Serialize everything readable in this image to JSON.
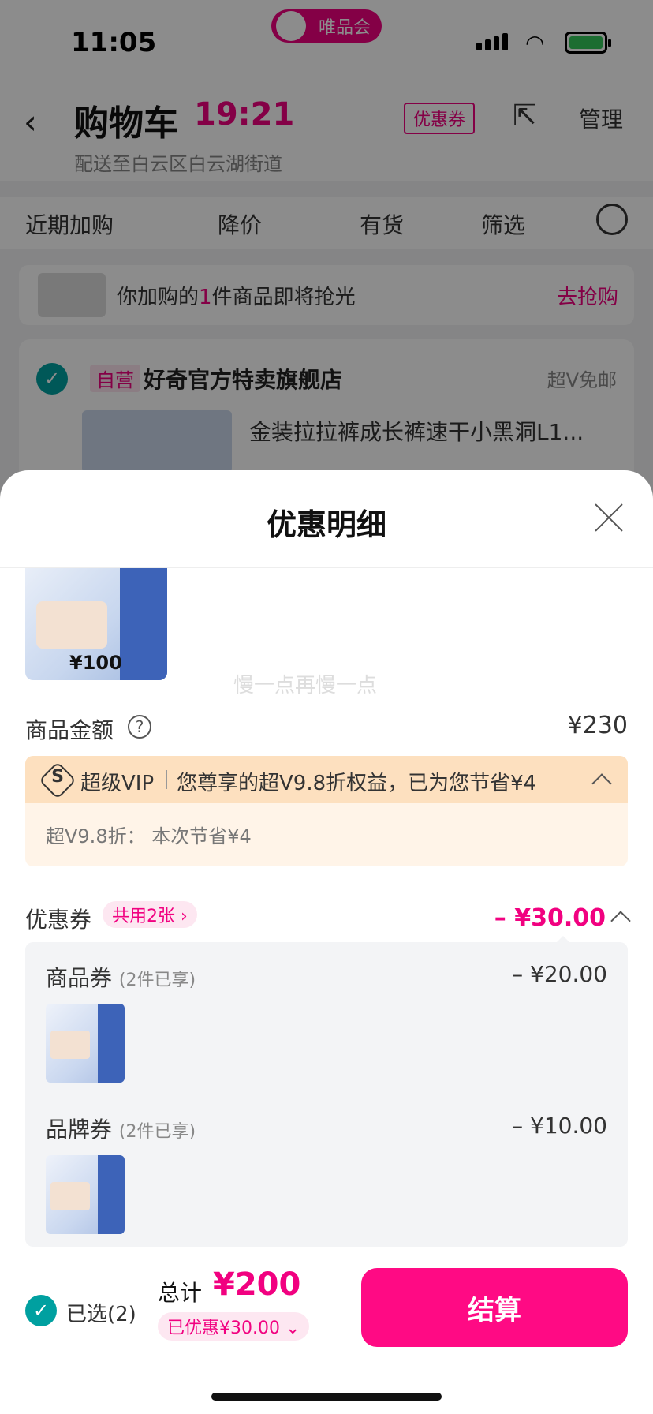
{
  "status_bar": {
    "time": "11:05",
    "app_pill": "唯品会"
  },
  "header": {
    "title": "购物车",
    "countdown": "19:21",
    "delivery": "配送至白云区白云湖街道",
    "coupon_tag": "优惠券",
    "manage": "管理"
  },
  "filters": {
    "items": [
      "近期加购",
      "降价",
      "有货",
      "筛选"
    ]
  },
  "notice": {
    "text_prefix": "你加购的",
    "text_count": "1",
    "text_suffix": "件商品即将抢光",
    "action": "去抢购"
  },
  "store": {
    "self_tag": "自营",
    "name": "好奇官方特卖旗舰店",
    "free_shipping": "超V免邮",
    "product_name": "金装拉拉裤成长裤速干小黑洞L1..."
  },
  "sheet": {
    "title": "优惠明细",
    "product_price": "¥100",
    "watermark": "慢一点再慢一点",
    "goods_amount_label": "商品金额",
    "goods_amount_value": "¥230",
    "vip": {
      "label": "超级VIP",
      "message": "您尊享的超V9.8折权益，已为您节省¥4",
      "detail": "超V9.8折：  本次节省¥4"
    },
    "coupons": {
      "label": "优惠券",
      "share_tag": "共用2张 ›",
      "total": "– ¥30.00",
      "items": [
        {
          "label": "商品券",
          "note": "(2件已享)",
          "amount": "– ¥20.00"
        },
        {
          "label": "品牌券",
          "note": "(2件已享)",
          "amount": "– ¥10.00"
        }
      ]
    }
  },
  "bottom_bar": {
    "selected": "已选(2)",
    "total_label": "总计",
    "total_value": "¥200",
    "discount": "已优惠¥30.00 ⌄",
    "checkout": "结算"
  },
  "colors": {
    "brand": "#f10180",
    "checkout": "#ff0a84",
    "teal": "#00a0a0",
    "vip_bg": "#fde0bf"
  }
}
